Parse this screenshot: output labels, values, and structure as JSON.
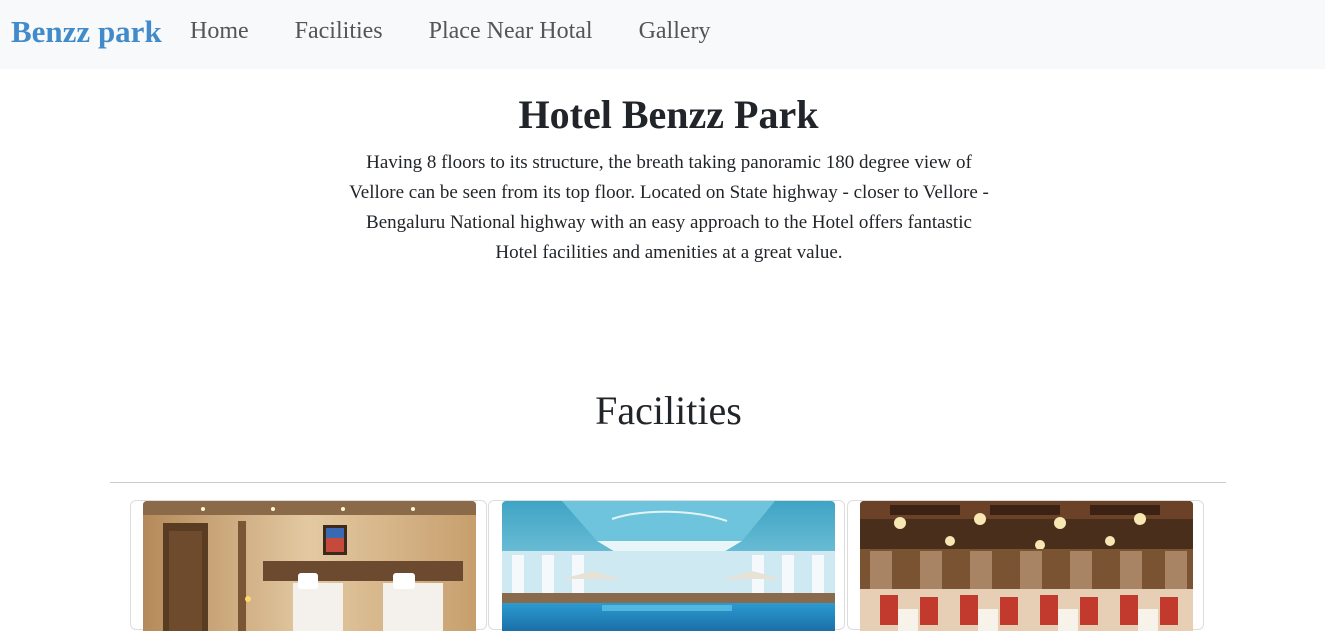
{
  "navbar": {
    "brand": "Benzz park",
    "links": [
      {
        "label": "Home"
      },
      {
        "label": "Facilities"
      },
      {
        "label": "Place Near Hotal"
      },
      {
        "label": "Gallery"
      }
    ]
  },
  "hero": {
    "title": "Hotel Benzz Park",
    "description": "Having 8 floors to its structure, the breath taking panoramic 180 degree view of Vellore can be seen from its top floor. Located on State highway - closer to Vellore - Bengaluru National highway with an easy approach to the Hotel offers fantastic Hotel facilities and amenities at a great value."
  },
  "facilities": {
    "title": "Facilities",
    "cards": [
      {
        "image": "hotel-room-photo"
      },
      {
        "image": "swimming-pool-photo"
      },
      {
        "image": "banquet-hall-photo"
      }
    ]
  },
  "colors": {
    "brand": "#428bca",
    "navbar_bg": "#f8f9fa",
    "nav_link": "#555555",
    "text": "#212529"
  }
}
